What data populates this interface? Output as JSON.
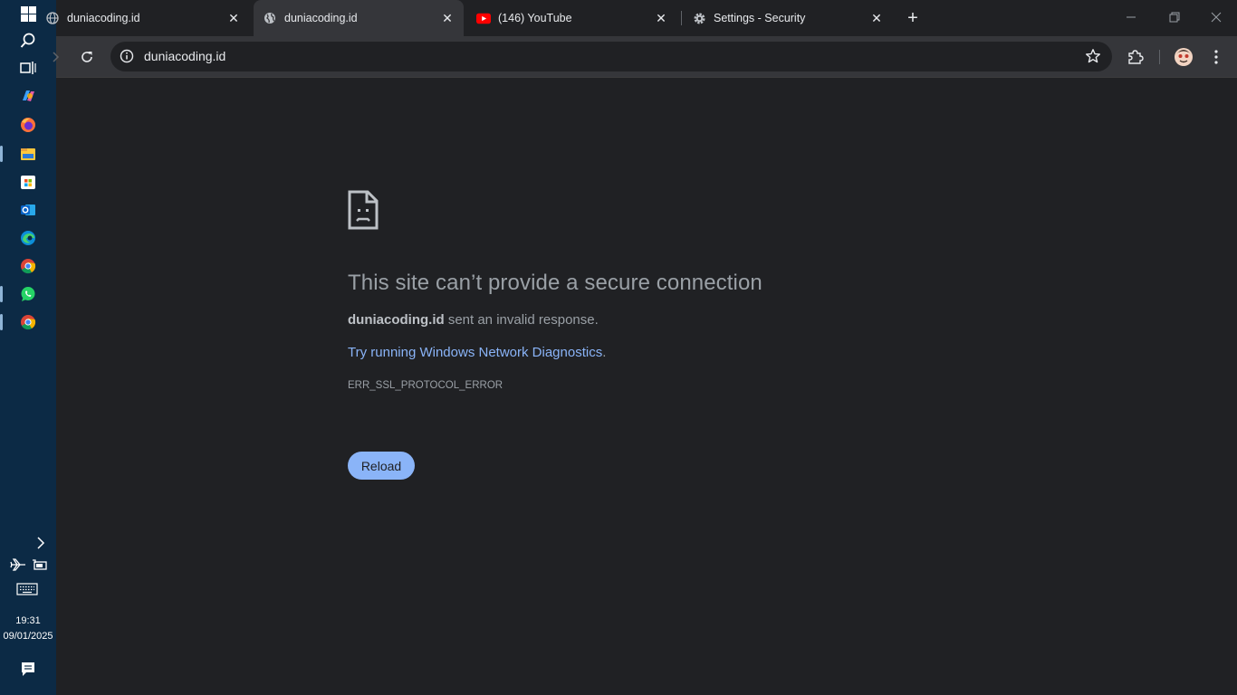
{
  "taskbar": {
    "time": "19:31",
    "date": "09/01/2025",
    "icons": [
      "windows-start-icon",
      "search-icon",
      "task-view-icon",
      "copilot-icon",
      "firefox-icon",
      "file-explorer-icon",
      "microsoft-store-icon",
      "outlook-icon",
      "edge-icon",
      "chrome-icon",
      "whatsapp-icon",
      "chrome-alt-icon"
    ]
  },
  "tabs": [
    {
      "title": "duniacoding.id",
      "icon": "globe-icon"
    },
    {
      "title": "duniacoding.id",
      "icon": "globe-icon",
      "active": true
    },
    {
      "title": "(146) YouTube",
      "icon": "youtube-icon"
    },
    {
      "title": "Settings - Security",
      "icon": "settings-gear-icon"
    }
  ],
  "omnibox": {
    "url": "duniacoding.id"
  },
  "error": {
    "title": "This site can’t provide a secure connection",
    "host": "duniacoding.id",
    "message_rest": " sent an invalid response.",
    "link_text": "Try running Windows Network Diagnostics",
    "link_suffix": ".",
    "code": "ERR_SSL_PROTOCOL_ERROR",
    "reload_label": "Reload"
  },
  "colors": {
    "accent": "#8ab4f8",
    "background": "#202124",
    "taskbar": "#0c2a45"
  }
}
